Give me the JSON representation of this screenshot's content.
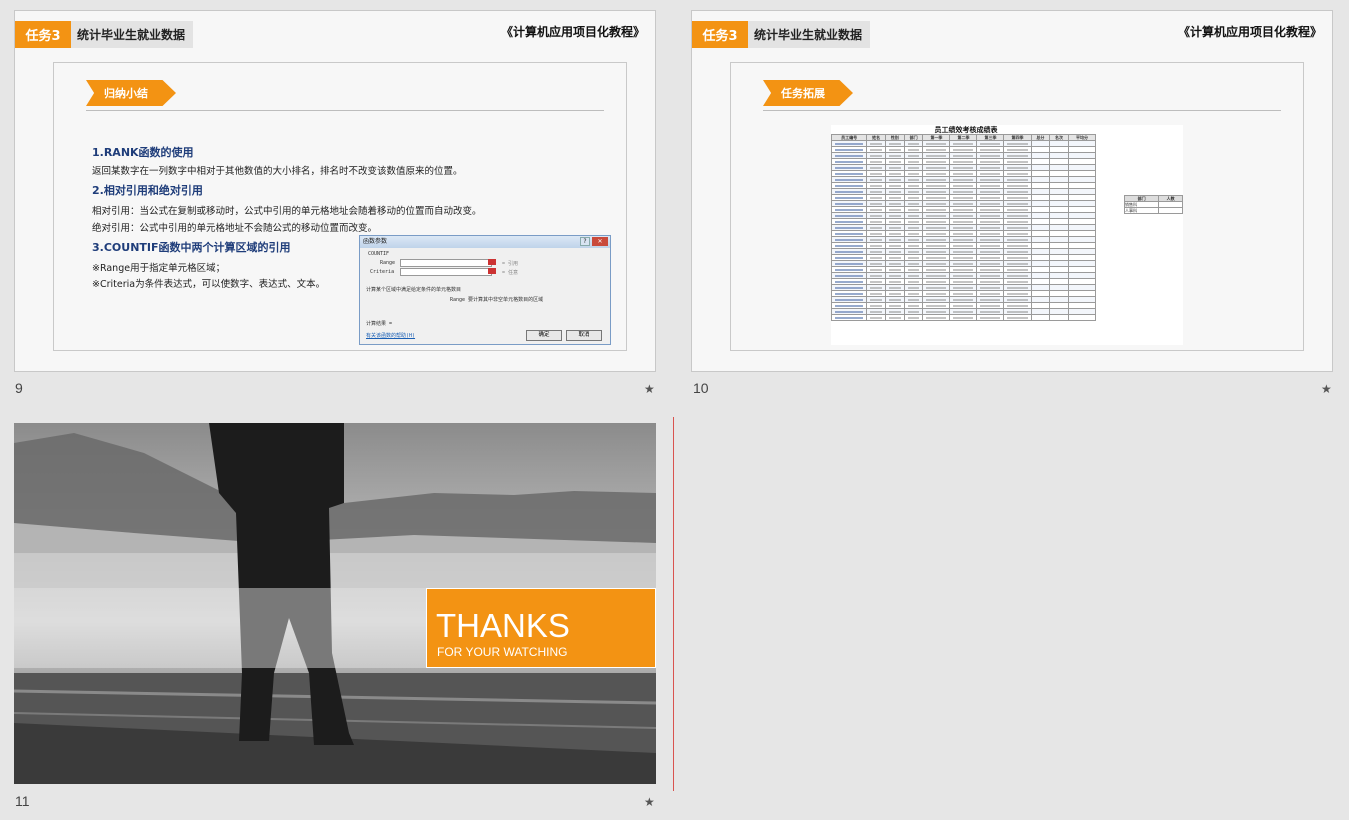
{
  "slides": [
    {
      "number": "9",
      "task_tag": "任务3",
      "task_title": "统计毕业生就业数据",
      "book_title": "《计算机应用项目化教程》",
      "section_label": "归纳小结",
      "headings": [
        "1.RANK函数的使用",
        "2.相对引用和绝对引用",
        "3.COUNTIF函数中两个计算区域的引用"
      ],
      "lines": {
        "rank_desc": "返回某数字在一列数字中相对于其他数值的大小排名，排名时不改变该数值原来的位置。",
        "relative": "相对引用：当公式在复制或移动时，公式中引用的单元格地址会随着移动的位置而自动改变。",
        "absolute": "绝对引用：公式中引用的单元格地址不会随公式的移动位置而改变。",
        "range": "※Range用于指定单元格区域；",
        "criteria": "※Criteria为条件表达式，可以使数字、表达式、文本。"
      },
      "dialog": {
        "title": "函数参数",
        "func": "COUNTIF",
        "range_label": "Range",
        "criteria_label": "Criteria",
        "range_hint": "= 引用",
        "criteria_hint": "= 任意",
        "desc1": "计算某个区域中满足给定条件的单元格数目",
        "desc2": "Range  要计算其中非空单元格数目的区域",
        "result": "计算结果 =",
        "help": "有关该函数的帮助(H)",
        "ok": "确定",
        "cancel": "取消"
      }
    },
    {
      "number": "10",
      "task_tag": "任务3",
      "task_title": "统计毕业生就业数据",
      "book_title": "《计算机应用项目化教程》",
      "section_label": "任务拓展",
      "sheet_title": "员工绩效考核成绩表",
      "sheet_headers": [
        "员工编号",
        "姓名",
        "性别",
        "部门",
        "第一季",
        "第二季",
        "第三季",
        "第四季",
        "总分",
        "名次",
        "平均分"
      ],
      "side_headers": [
        "部门",
        "人数"
      ],
      "side_rows": [
        "销售科",
        "人事科"
      ]
    },
    {
      "number": "11",
      "thanks": "THANKS",
      "thanks_sub": "FOR YOUR WATCHING"
    }
  ],
  "star_icon": "★",
  "colors": {
    "accent": "#f39313",
    "heading": "#1f3d7a",
    "background": "#e6e6e6"
  }
}
